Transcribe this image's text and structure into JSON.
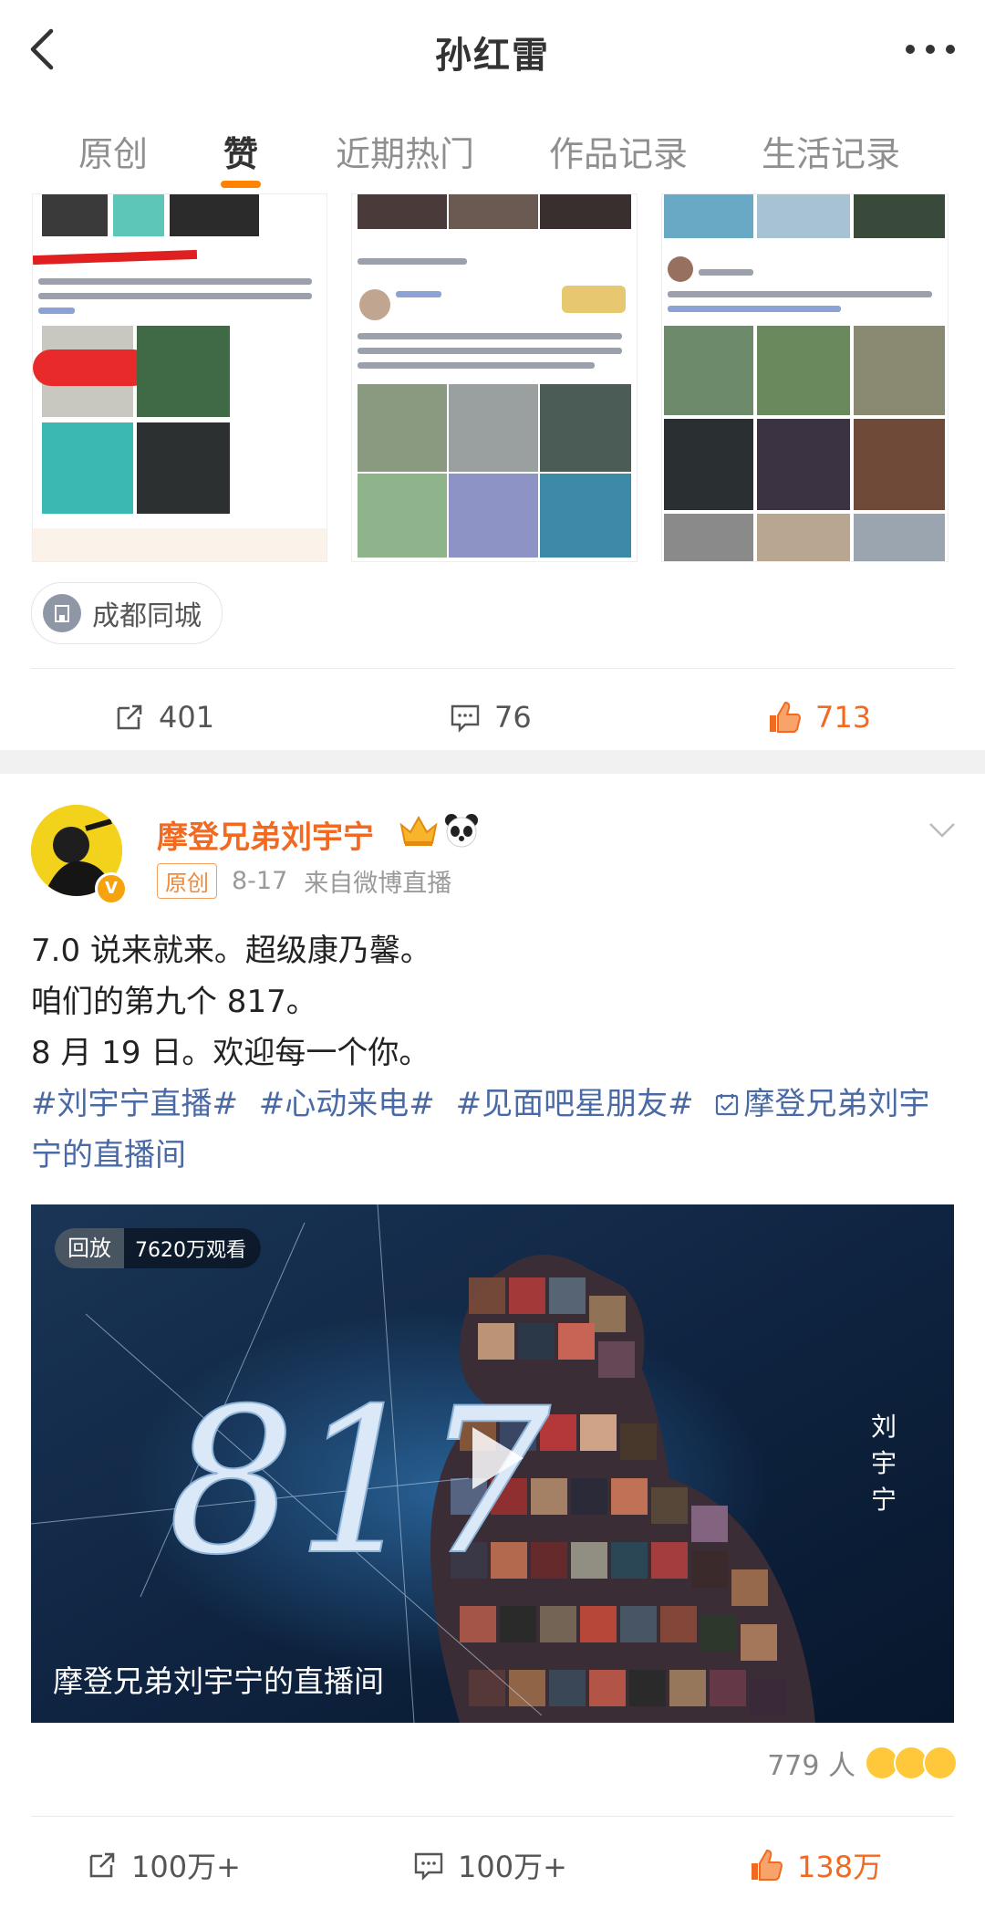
{
  "header": {
    "title": "孙红雷"
  },
  "tabs": [
    "原创",
    "赞",
    "近期热门",
    "作品记录",
    "生活记录"
  ],
  "active_tab": "赞",
  "post1": {
    "location": "成都同城",
    "repost": "401",
    "comment": "76",
    "like": "713"
  },
  "post2": {
    "user": "摩登兄弟刘宇宁",
    "badge": "原创",
    "date": "8-17",
    "source": "来自微博直播",
    "lines": [
      "7.0 说来就来。超级康乃馨。",
      "咱们的第九个 817。",
      "8 月 19 日。欢迎每一个你。"
    ],
    "hashtags": [
      "#刘宇宁直播#",
      "#心动来电#",
      "#见面吧星朋友#",
      "摩登兄弟刘宇宁的直播间"
    ],
    "video": {
      "tag": "回放",
      "views": "7620万观看",
      "title": "817",
      "caption": "摩登兄弟刘宇宁的直播间",
      "side_name": "刘宇宁"
    },
    "reactions": "779 人",
    "repost": "100万+",
    "comment": "100万+",
    "like": "138万"
  },
  "colors": {
    "accent": "#ff8200",
    "like": "#f26a21",
    "link": "#4a6aa6"
  }
}
